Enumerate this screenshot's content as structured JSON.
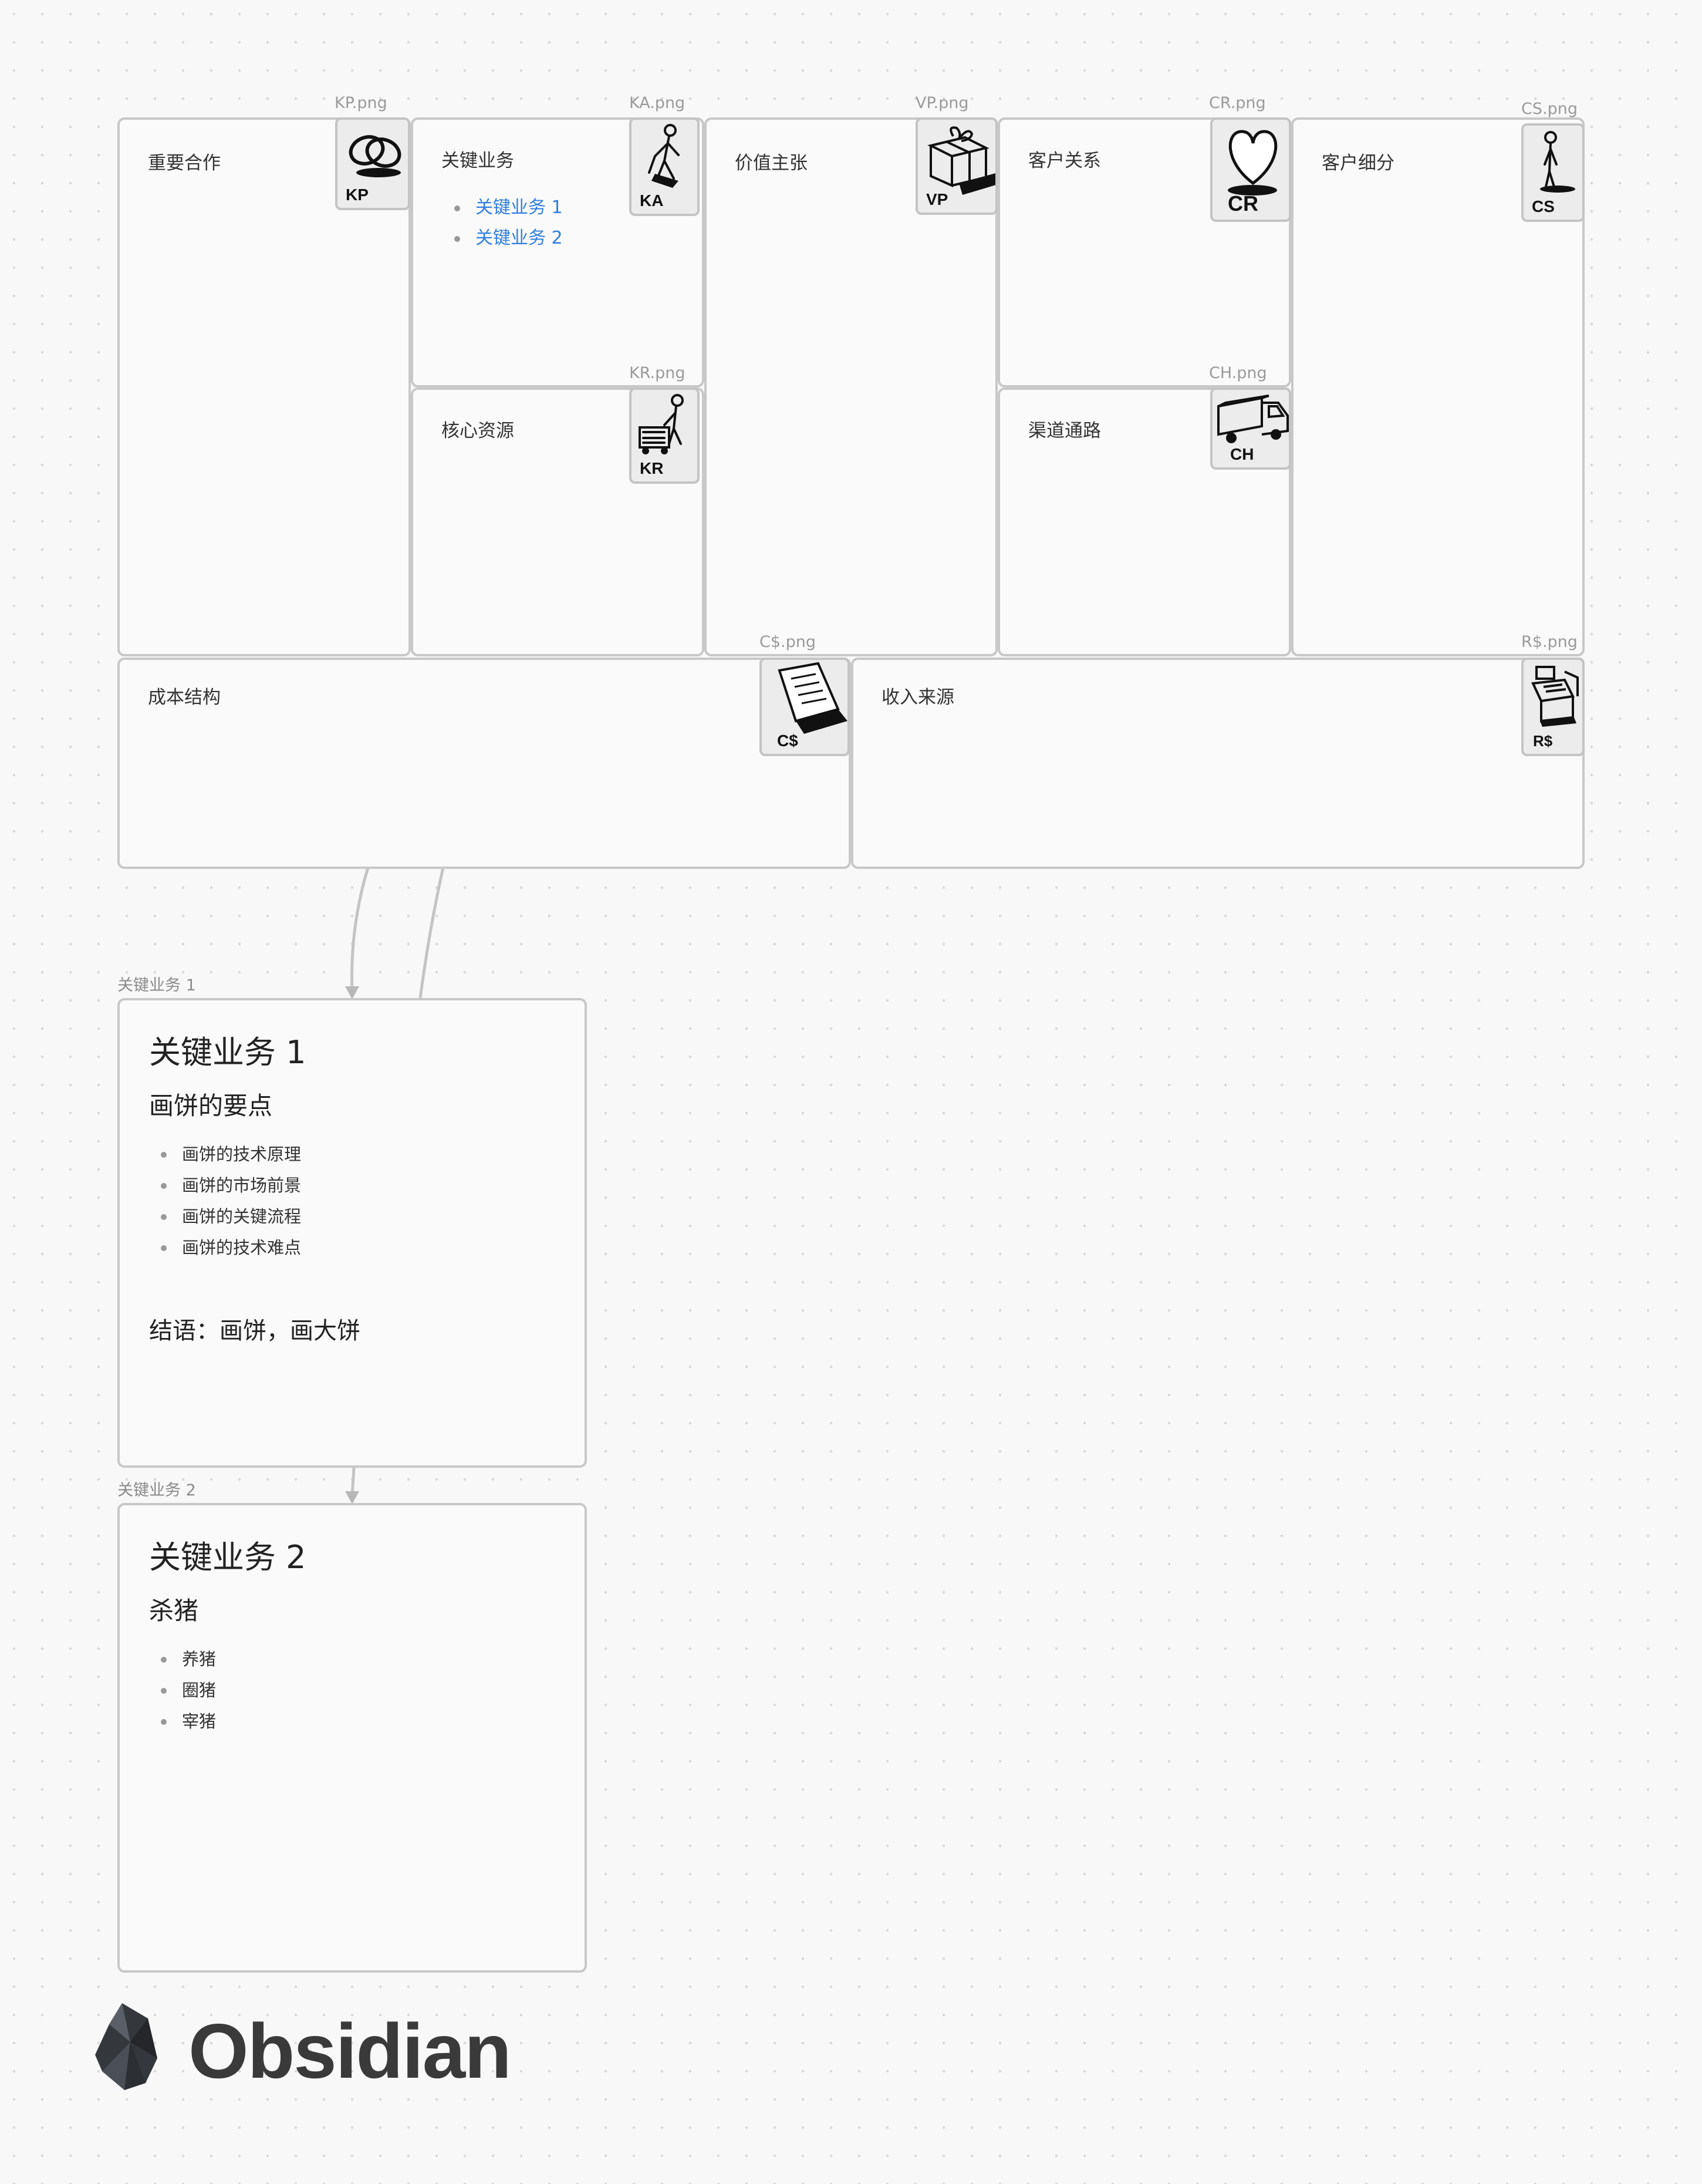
{
  "canvas": {
    "blocks": {
      "kp": {
        "title": "重要合作",
        "file": "KP.png",
        "code": "KP",
        "icon": "interlocking-rings-icon"
      },
      "ka": {
        "title": "关键业务",
        "file": "KA.png",
        "code": "KA",
        "icon": "worker-icon",
        "links": [
          "关键业务 1",
          "关键业务 2"
        ]
      },
      "kr": {
        "title": "核心资源",
        "file": "KR.png",
        "code": "KR",
        "icon": "worker-cart-icon"
      },
      "vp": {
        "title": "价值主张",
        "file": "VP.png",
        "code": "VP",
        "icon": "gift-box-icon"
      },
      "cr": {
        "title": "客户关系",
        "file": "CR.png",
        "code": "CR",
        "icon": "heart-icon"
      },
      "ch": {
        "title": "渠道通路",
        "file": "CH.png",
        "code": "CH",
        "icon": "truck-icon"
      },
      "cs": {
        "title": "客户细分",
        "file": "CS.png",
        "code": "CS",
        "icon": "person-icon"
      },
      "cost": {
        "title": "成本结构",
        "file": "C$.png",
        "code": "C$",
        "icon": "document-icon"
      },
      "rev": {
        "title": "收入来源",
        "file": "R$.png",
        "code": "R$",
        "icon": "cash-register-icon"
      }
    },
    "notes": [
      {
        "label": "关键业务 1",
        "heading": "关键业务 1",
        "subheading": "画饼的要点",
        "items": [
          "画饼的技术原理",
          "画饼的市场前景",
          "画饼的关键流程",
          "画饼的技术难点"
        ],
        "conclusion": "结语：画饼，画大饼"
      },
      {
        "label": "关键业务 2",
        "heading": "关键业务 2",
        "subheading": "杀猪",
        "items": [
          "养猪",
          "圈猪",
          "宰猪"
        ]
      }
    ]
  },
  "brand": {
    "name": "Obsidian",
    "icon": "obsidian-logo-icon"
  }
}
